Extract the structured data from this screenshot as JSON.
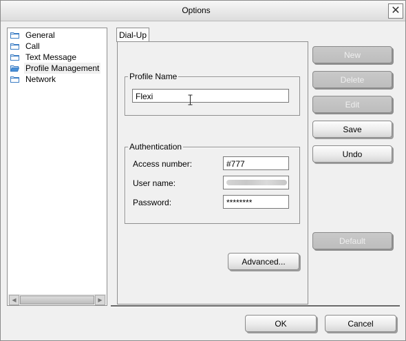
{
  "window": {
    "title": "Options",
    "close_icon": "close-icon"
  },
  "tree": {
    "items": [
      {
        "label": "General",
        "icon": "folder-icon"
      },
      {
        "label": "Call",
        "icon": "folder-icon"
      },
      {
        "label": "Text Message",
        "icon": "folder-icon"
      },
      {
        "label": "Profile Management",
        "icon": "folder-open-icon",
        "selected": true
      },
      {
        "label": "Network",
        "icon": "folder-icon"
      }
    ]
  },
  "tabs": [
    {
      "label": "Dial-Up",
      "active": true
    }
  ],
  "profile": {
    "group_label": "Profile Name",
    "name_value": "Flexi"
  },
  "auth": {
    "group_label": "Authentication",
    "access_label": "Access number:",
    "access_value": "#777",
    "user_label": "User name:",
    "user_value": "",
    "password_label": "Password:",
    "password_value": "********"
  },
  "buttons": {
    "new": "New",
    "delete": "Delete",
    "edit": "Edit",
    "save": "Save",
    "undo": "Undo",
    "default": "Default",
    "advanced": "Advanced...",
    "ok": "OK",
    "cancel": "Cancel"
  },
  "colors": {
    "folder": "#4a90d6",
    "disabled_button": "#c4c4c4"
  }
}
